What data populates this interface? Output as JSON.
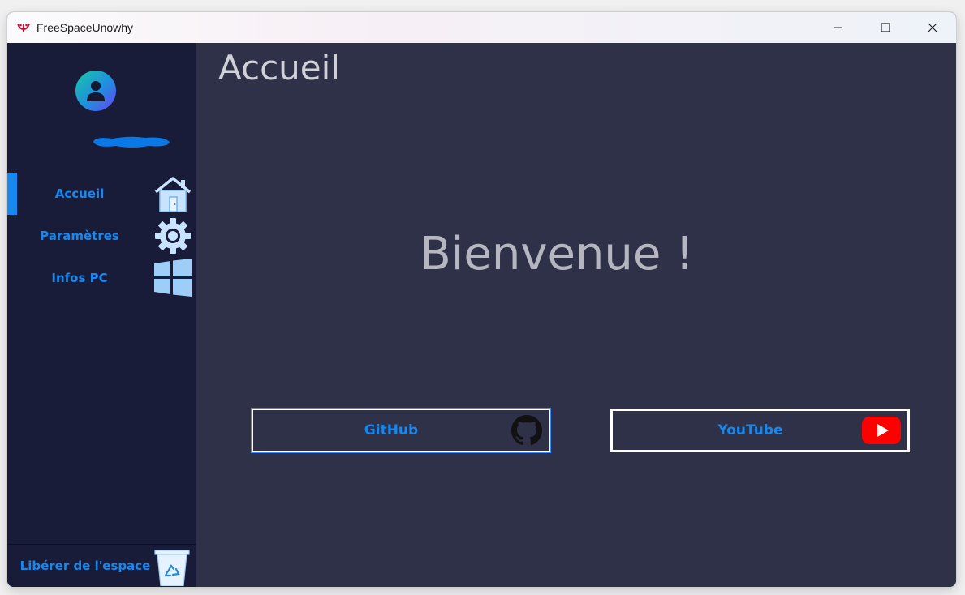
{
  "window": {
    "title": "FreeSpaceUnowhy",
    "controls": [
      "minimize-icon",
      "maximize-icon",
      "close-icon"
    ]
  },
  "sidebar": {
    "avatar_icon": "user-icon",
    "items": [
      {
        "label": "Accueil",
        "icon": "home-icon",
        "active": true
      },
      {
        "label": "Paramètres",
        "icon": "gear-icon",
        "active": false
      },
      {
        "label": "Infos PC",
        "icon": "windows-logo-icon",
        "active": false
      }
    ],
    "footer": {
      "label": "Libérer de l'espace",
      "icon": "recycle-bin-icon"
    }
  },
  "main": {
    "page_title": "Accueil",
    "welcome": "Bienvenue !",
    "buttons": [
      {
        "label": "GitHub",
        "icon": "github-icon"
      },
      {
        "label": "YouTube",
        "icon": "youtube-icon"
      }
    ]
  },
  "colors": {
    "sidebar_bg": "#191c39",
    "main_bg": "#2e3148",
    "accent": "#1688f0",
    "youtube_red": "#ff0000"
  }
}
